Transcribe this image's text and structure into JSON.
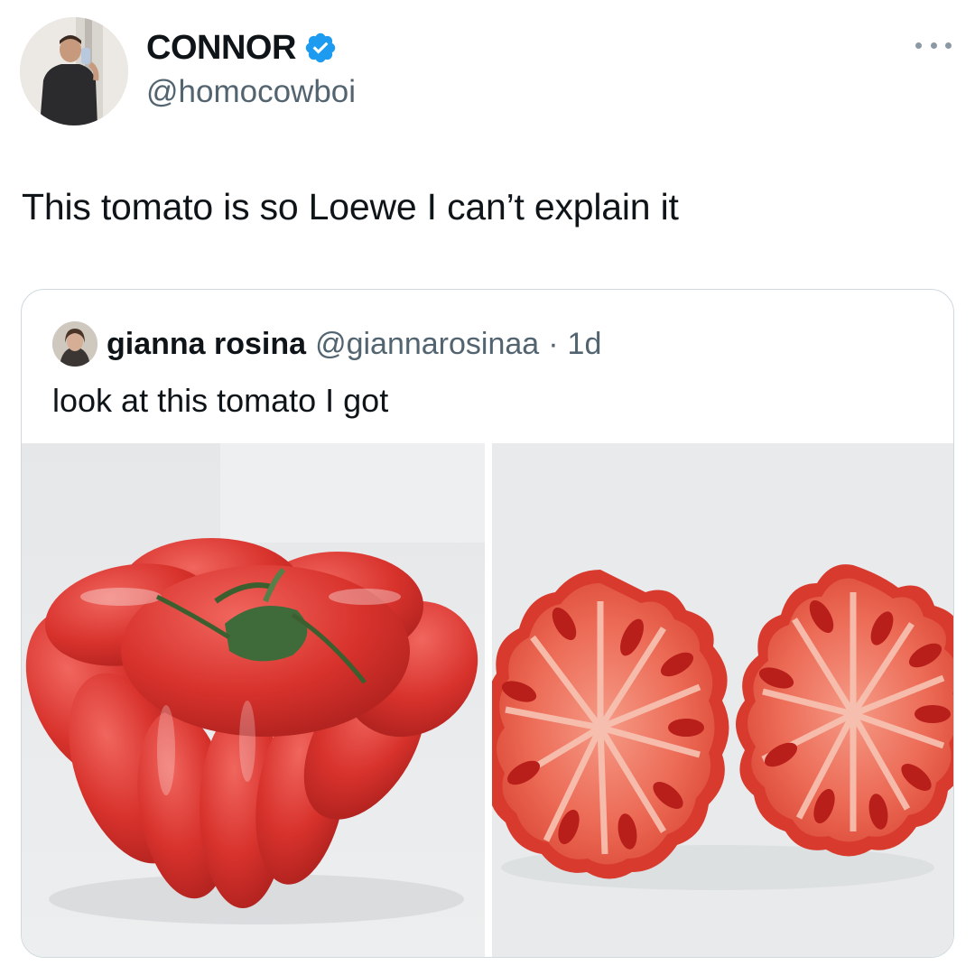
{
  "tweet": {
    "author": {
      "display_name": "CONNOR",
      "handle": "@homocowboi",
      "verified": true,
      "avatar_icon": "user-avatar"
    },
    "menu_icon": "more-options-icon",
    "text": "This tomato is so Loewe I can’t explain it",
    "quoted_tweet": {
      "author": {
        "display_name": "gianna rosina",
        "handle": "@giannarosinaa",
        "avatar_icon": "user-avatar"
      },
      "separator": "·",
      "time_ago": "1d",
      "text": "look at this tomato I got",
      "media": [
        {
          "icon": "whole-tomato-photo"
        },
        {
          "icon": "sliced-tomato-photo"
        }
      ]
    }
  },
  "colors": {
    "text_primary": "#0f1419",
    "text_secondary": "#536471",
    "verified_badge": "#1d9bf0",
    "border": "#cfd9de",
    "tomato_red": "#d9302b"
  }
}
